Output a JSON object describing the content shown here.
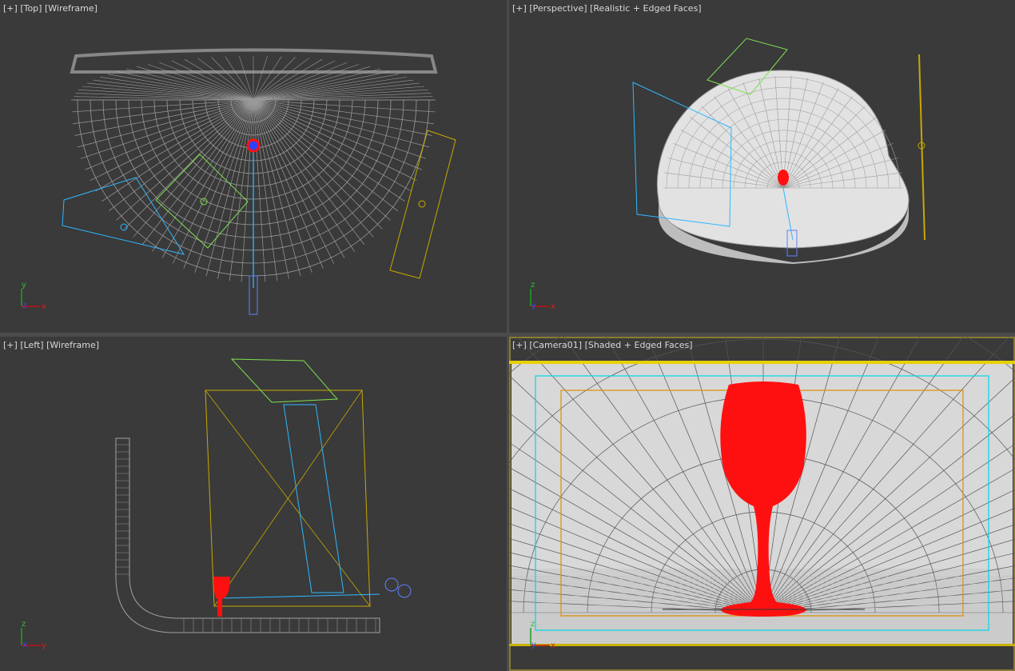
{
  "viewports": [
    {
      "id": "top",
      "plus": "[+]",
      "view": "[Top]",
      "mode": "[Wireframe]",
      "axes": {
        "up": "y",
        "right": "x",
        "out": "z"
      }
    },
    {
      "id": "perspective",
      "plus": "[+]",
      "view": "[Perspective]",
      "mode": "[Realistic + Edged Faces]",
      "axes": {
        "up": "z",
        "right": "x",
        "out": "y"
      }
    },
    {
      "id": "left",
      "plus": "[+]",
      "view": "[Left]",
      "mode": "[Wireframe]",
      "axes": {
        "up": "z",
        "right": "y",
        "out": "x"
      }
    },
    {
      "id": "camera",
      "plus": "[+]",
      "view": "[Camera01]",
      "mode": "[Shaded + Edged Faces]",
      "axes": {
        "up": "z",
        "right": "x",
        "out": "y"
      }
    }
  ],
  "colors": {
    "viewport_bg": "#3a3a3a",
    "active_border": "#8a7a30",
    "glass": "#ff1010",
    "camera": "#2fb8ff",
    "light_green": "#7fe050",
    "light_yellow": "#c8a800",
    "wire": "#9a9a9a"
  }
}
